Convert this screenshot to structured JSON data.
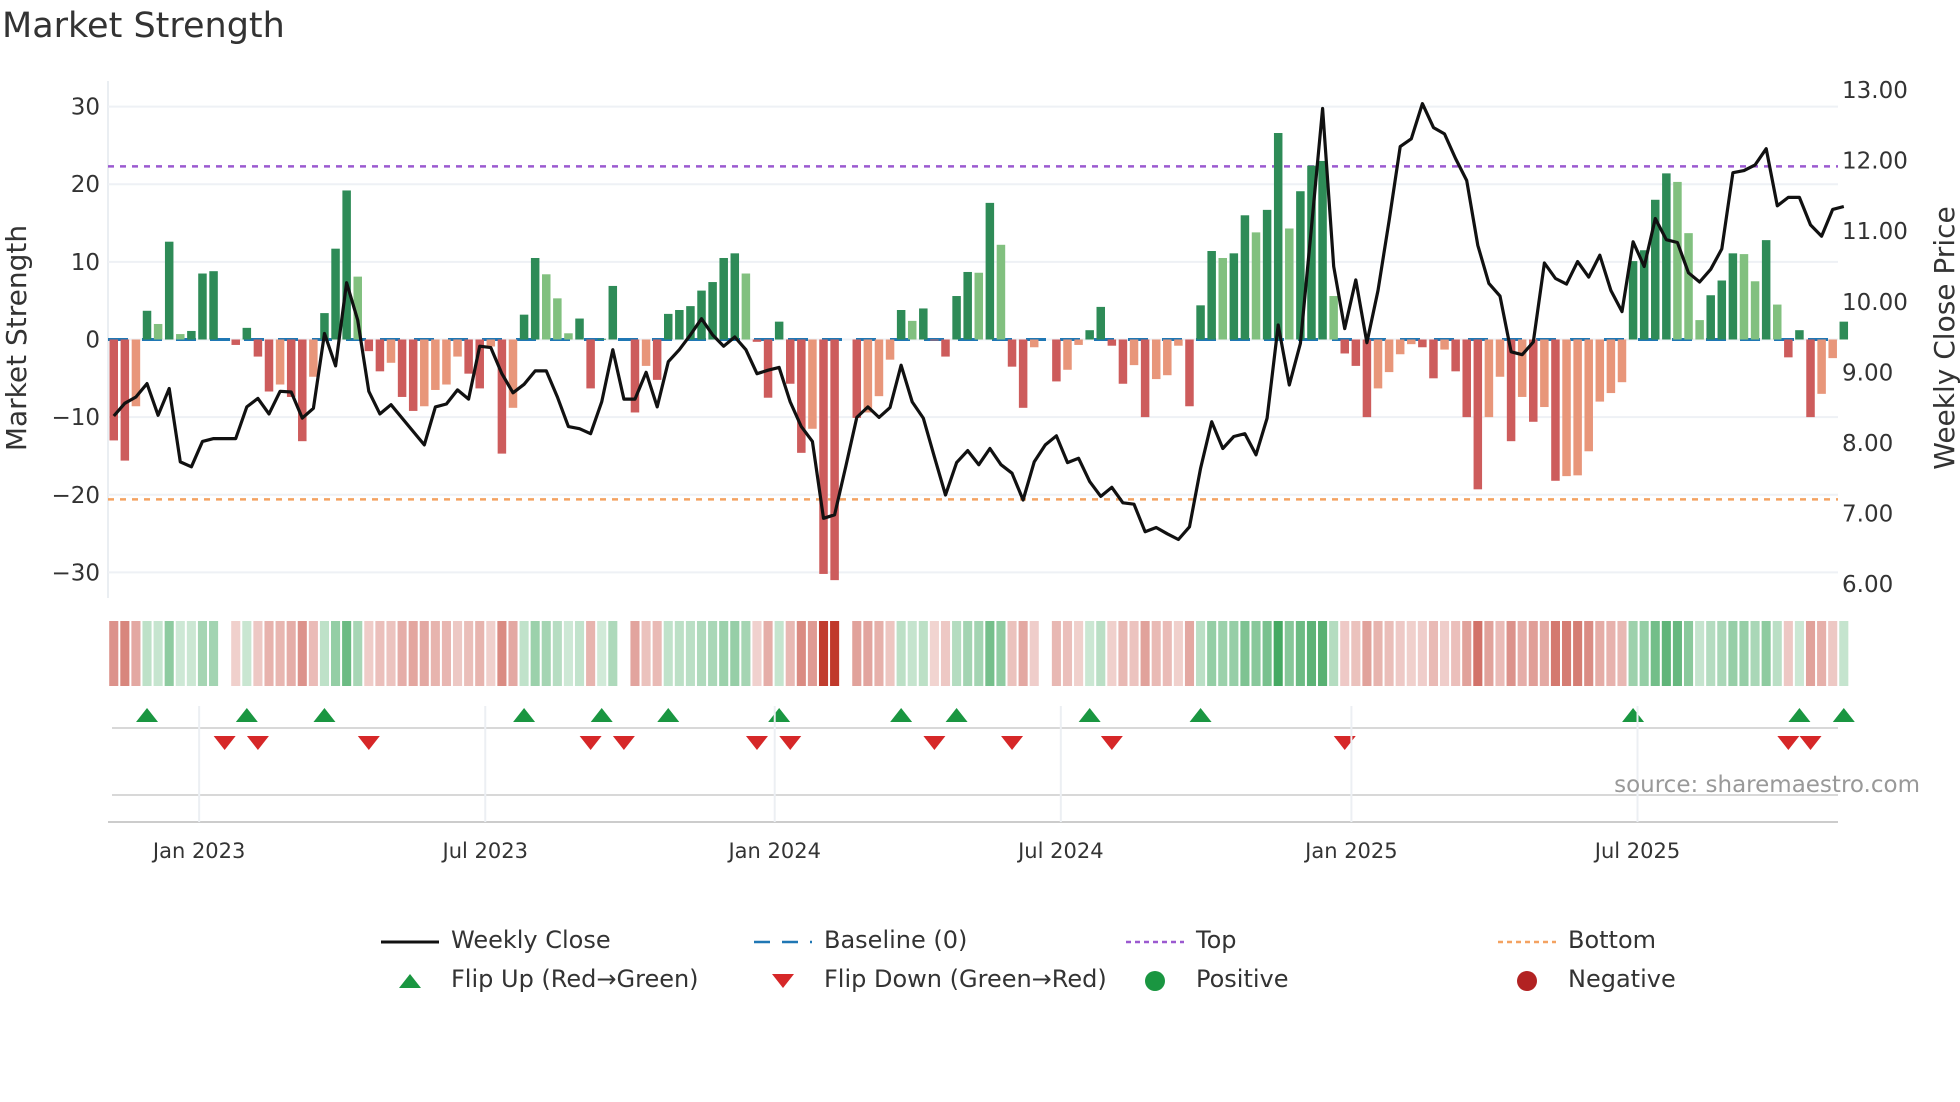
{
  "title": "Market Strength",
  "source": "source: sharemaestro.com",
  "colors": {
    "pos_strong": "#2e8b57",
    "pos_weak": "#81c07f",
    "neg_strong": "#cd5c5c",
    "neg_weak": "#e8967a",
    "line": "#111111",
    "baseline": "#1f77b4",
    "top": "#9b59d0",
    "bottom": "#f4a261",
    "flip_up": "#1a9641",
    "flip_down": "#d62728",
    "positive": "#1a9641",
    "negative": "#b22222"
  },
  "chart_data": {
    "type": "bar",
    "title": "Market Strength",
    "ylabel": "Market Strength",
    "y2label": "Weekly Close Price",
    "ylim": [
      -33.3,
      33.3
    ],
    "y2lim": [
      5.8,
      13.13
    ],
    "yticks": [
      "30",
      "20",
      "10",
      "0",
      "−10",
      "−20",
      "−30"
    ],
    "ytick_values": [
      30,
      20,
      10,
      0,
      -10,
      -20,
      -30
    ],
    "y2ticks": [
      "13.00",
      "12.00",
      "11.00",
      "10.00",
      "9.00",
      "8.00",
      "7.00",
      "6.00"
    ],
    "y2tick_values": [
      13,
      12,
      11,
      10,
      9,
      8,
      7,
      6
    ],
    "xticks": [
      {
        "label": "Jan 2023",
        "week": 7.7
      },
      {
        "label": "Jul 2023",
        "week": 33.5
      },
      {
        "label": "Jan 2024",
        "week": 59.6
      },
      {
        "label": "Jul 2024",
        "week": 85.4
      },
      {
        "label": "Jan 2025",
        "week": 111.6
      },
      {
        "label": "Jul 2025",
        "week": 137.4
      }
    ],
    "top_level": 22.3,
    "bottom_level": -20.6,
    "baseline": 0,
    "strength": [
      -13,
      -15.6,
      -8.6,
      3.7,
      2,
      12.6,
      0.7,
      1.1,
      8.5,
      8.8,
      0,
      -0.7,
      1.5,
      -2.2,
      -6.7,
      -5.8,
      -7.4,
      -13.1,
      -4.8,
      3.4,
      11.7,
      19.2,
      8.1,
      -1.5,
      -4.1,
      -3,
      -7.4,
      -9.2,
      -8.6,
      -6.5,
      -5.8,
      -2.2,
      -4.4,
      -6.3,
      -0.9,
      -14.7,
      -8.8,
      3.2,
      10.5,
      8.4,
      5.3,
      0.8,
      2.7,
      -6.3,
      0.1,
      6.9,
      0,
      -9.4,
      -3.4,
      -5.2,
      3.3,
      3.8,
      4.3,
      6.3,
      7.4,
      10.5,
      11.1,
      8.5,
      -0.3,
      -7.5,
      2.3,
      -5.7,
      -14.6,
      -11.5,
      -30.2,
      -31,
      0,
      -10.1,
      -9.4,
      -7.3,
      -2.6,
      3.8,
      2.4,
      4,
      -0.1,
      -2.2,
      5.6,
      8.7,
      8.6,
      17.6,
      12.2,
      -3.5,
      -8.8,
      -1,
      0,
      -5.4,
      -3.9,
      -0.7,
      1.2,
      4.2,
      -0.8,
      -5.7,
      -3.3,
      -10,
      -5.1,
      -4.6,
      -0.8,
      -8.6,
      4.4,
      11.4,
      10.5,
      11.1,
      16,
      13.8,
      16.7,
      26.6,
      14.3,
      19.1,
      22.4,
      23,
      5.6,
      -1.8,
      -3.4,
      -10,
      -6.3,
      -4.2,
      -1.9,
      -0.6,
      -1,
      -5,
      -1.3,
      -4.1,
      -10,
      -19.3,
      -10,
      -4.8,
      -13.1,
      -7.4,
      -10.6,
      -8.7,
      -18.2,
      -17.6,
      -17.5,
      -14.4,
      -8,
      -6.9,
      -5.5,
      10.1,
      11.5,
      18,
      21.4,
      20.3,
      13.7,
      2.5,
      5.7,
      7.6,
      11.1,
      11,
      7.5,
      12.8,
      4.5,
      -2.3,
      1.2,
      -10,
      -7,
      -2.4,
      2.3
    ],
    "weekly_close": [
      8.38,
      8.56,
      8.65,
      8.84,
      8.39,
      8.77,
      7.73,
      7.66,
      8.02,
      8.06,
      8.06,
      8.06,
      8.51,
      8.63,
      8.41,
      8.73,
      8.72,
      8.35,
      8.49,
      9.55,
      9.09,
      10.27,
      9.74,
      8.73,
      8.41,
      8.54,
      8.35,
      8.16,
      7.97,
      8.51,
      8.55,
      8.75,
      8.62,
      9.37,
      9.35,
      8.98,
      8.71,
      8.83,
      9.02,
      9.02,
      8.65,
      8.23,
      8.2,
      8.13,
      8.58,
      9.32,
      8.62,
      8.62,
      9.0,
      8.51,
      9.15,
      9.32,
      9.53,
      9.76,
      9.53,
      9.37,
      9.5,
      9.32,
      8.98,
      9.03,
      9.07,
      8.58,
      8.23,
      8.02,
      6.93,
      6.98,
      7.66,
      8.36,
      8.51,
      8.36,
      8.5,
      9.1,
      8.58,
      8.35,
      7.8,
      7.26,
      7.72,
      7.89,
      7.69,
      7.92,
      7.69,
      7.57,
      7.19,
      7.73,
      7.97,
      8.1,
      7.72,
      7.78,
      7.45,
      7.24,
      7.37,
      7.15,
      7.13,
      6.74,
      6.8,
      6.71,
      6.63,
      6.81,
      7.64,
      8.3,
      7.92,
      8.09,
      8.13,
      7.83,
      8.35,
      9.67,
      8.82,
      9.41,
      11.06,
      12.74,
      10.5,
      9.62,
      10.31,
      9.42,
      10.16,
      11.15,
      12.2,
      12.31,
      12.81,
      12.47,
      12.38,
      12.03,
      11.72,
      10.8,
      10.26,
      10.08,
      9.29,
      9.25,
      9.43,
      10.55,
      10.33,
      10.25,
      10.57,
      10.35,
      10.66,
      10.16,
      9.86,
      10.85,
      10.5,
      11.18,
      10.88,
      10.84,
      10.41,
      10.28,
      10.46,
      10.75,
      11.83,
      11.86,
      11.94,
      12.17,
      11.36,
      11.48,
      11.48,
      11.09,
      10.93,
      11.31,
      11.35
    ],
    "legend": [
      {
        "label": "Weekly Close",
        "kind": "line"
      },
      {
        "label": "Baseline (0)",
        "kind": "dash"
      },
      {
        "label": "Top",
        "kind": "dot-purple"
      },
      {
        "label": "Bottom",
        "kind": "dot-orange"
      },
      {
        "label": "Flip Up (Red→Green)",
        "kind": "tri-up"
      },
      {
        "label": "Flip Down (Green→Red)",
        "kind": "tri-down"
      },
      {
        "label": "Positive",
        "kind": "dot-green"
      },
      {
        "label": "Negative",
        "kind": "dot-red"
      }
    ],
    "legend_position": "bottom"
  }
}
